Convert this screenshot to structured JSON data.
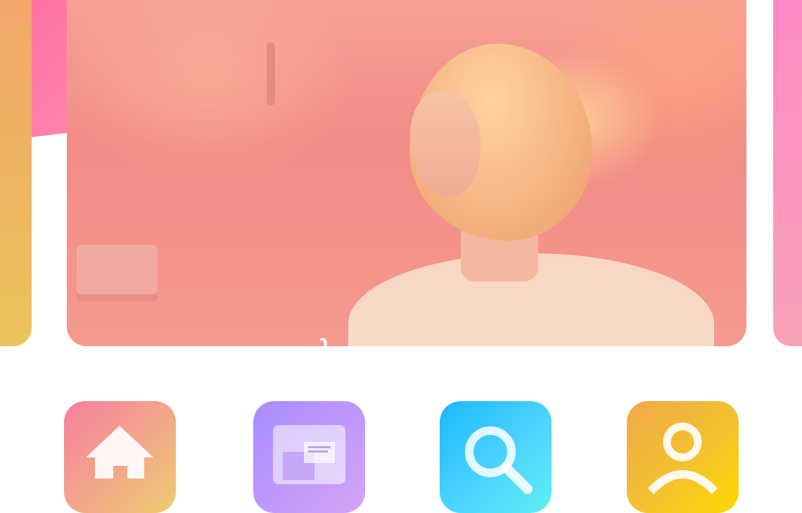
{
  "hero": {
    "caption": "ɿ"
  },
  "dock": {
    "apps": [
      {
        "name": "home",
        "icon": "home-icon"
      },
      {
        "name": "gallery",
        "icon": "gallery-icon"
      },
      {
        "name": "search",
        "icon": "search-icon"
      },
      {
        "name": "profile",
        "icon": "profile-icon"
      }
    ]
  },
  "colors": {
    "home": "#f57fa0",
    "gallery": "#a88cff",
    "search": "#1bb8ff",
    "profile": "#f3c22f"
  }
}
